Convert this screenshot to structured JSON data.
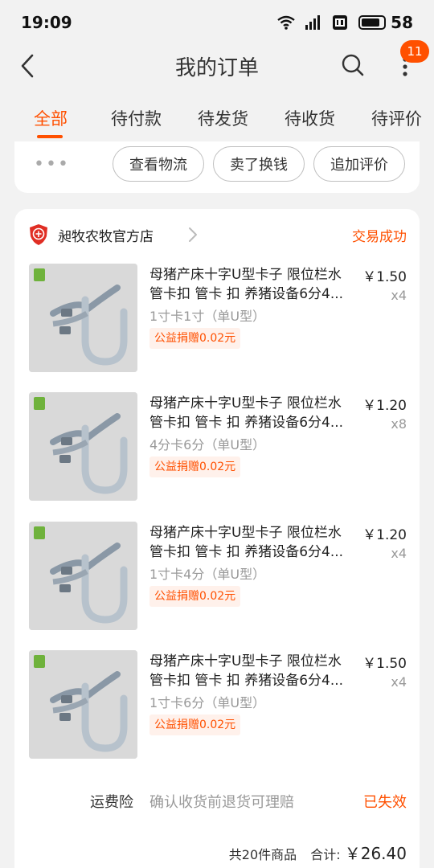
{
  "status_bar": {
    "time": "19:09",
    "battery": "58"
  },
  "nav": {
    "title": "我的订单",
    "badge": "11"
  },
  "tabs": [
    {
      "label": "全部",
      "active": true
    },
    {
      "label": "待付款"
    },
    {
      "label": "待发货"
    },
    {
      "label": "待收货"
    },
    {
      "label": "待评价"
    }
  ],
  "prev_order": {
    "dots": "•••",
    "buttons": [
      "查看物流",
      "卖了换钱",
      "追加评价"
    ]
  },
  "order": {
    "shop_name": "昶牧农牧官方店",
    "status": "交易成功",
    "items": [
      {
        "title": "母猪产床十字U型卡子 限位栏水管卡扣 管卡 扣 养猪设备6分4...",
        "sku": "1寸卡1寸（单U型）",
        "tag": "公益捐赠0.02元",
        "price": "￥1.50",
        "qty": "x4"
      },
      {
        "title": "母猪产床十字U型卡子 限位栏水管卡扣 管卡 扣 养猪设备6分4...",
        "sku": "4分卡6分（单U型）",
        "tag": "公益捐赠0.02元",
        "price": "￥1.20",
        "qty": "x8"
      },
      {
        "title": "母猪产床十字U型卡子 限位栏水管卡扣 管卡 扣 养猪设备6分4...",
        "sku": "1寸卡4分（单U型）",
        "tag": "公益捐赠0.02元",
        "price": "￥1.20",
        "qty": "x4"
      },
      {
        "title": "母猪产床十字U型卡子 限位栏水管卡扣 管卡 扣 养猪设备6分4...",
        "sku": "1寸卡6分（单U型）",
        "tag": "公益捐赠0.02元",
        "price": "￥1.50",
        "qty": "x4"
      }
    ],
    "insurance": {
      "label": "运费险",
      "desc": "确认收货前退货可理赔",
      "status": "已失效"
    },
    "total": {
      "count_text": "共20件商品",
      "label": "合计:",
      "amount": "￥26.40"
    }
  },
  "colors": {
    "accent": "#ff5000",
    "background": "#f2f2f2"
  }
}
